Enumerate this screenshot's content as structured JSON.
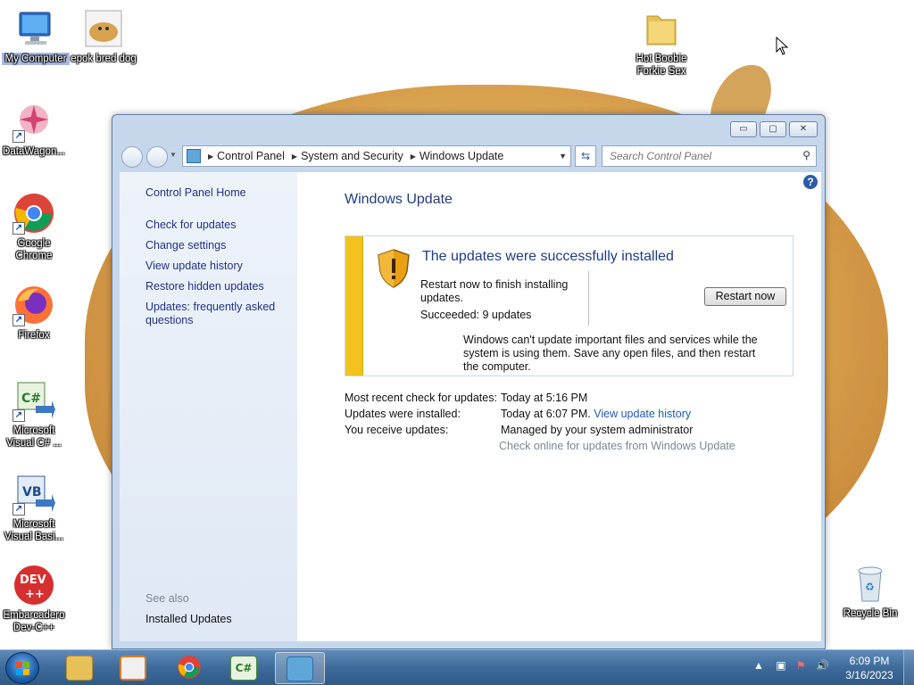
{
  "desktop_icons": [
    {
      "name": "My Computer",
      "label": "My Computer"
    },
    {
      "name": "epok bred dog",
      "label": "epok bred dog"
    },
    {
      "name": "Hot Boobie Forkie Sex",
      "label": "Hot Boobie Forkie Sex"
    },
    {
      "name": "DataWagon",
      "label": "DataWagon..."
    },
    {
      "name": "Google Chrome",
      "label": "Google Chrome"
    },
    {
      "name": "Firefox",
      "label": "Firefox"
    },
    {
      "name": "Microsoft Visual C#",
      "label": "Microsoft Visual C# ..."
    },
    {
      "name": "Microsoft Visual Basic",
      "label": "Microsoft Visual Basi..."
    },
    {
      "name": "Embarcadero Dev-C++",
      "label": "Embarcadero Dev-C++"
    },
    {
      "name": "Recycle Bin",
      "label": "Recycle Bin"
    }
  ],
  "window": {
    "title_buttons": {
      "minimize": "▭",
      "maximize": "▢",
      "close": "✕"
    },
    "breadcrumb": [
      "Control Panel",
      "System and Security",
      "Windows Update"
    ],
    "search_placeholder": "Search Control Panel"
  },
  "sidebar": {
    "home": "Control Panel Home",
    "links": [
      "Check for updates",
      "Change settings",
      "View update history",
      "Restore hidden updates",
      "Updates: frequently asked questions"
    ],
    "see_also": "See also",
    "installed_updates": "Installed Updates"
  },
  "main": {
    "title": "Windows Update",
    "status_panel": {
      "heading": "The updates were successfully installed",
      "restart_text": "Restart now to finish installing updates.",
      "succeeded": "Succeeded: 9 updates",
      "button_label": "Restart now",
      "warning_text": "Windows can't update important files and services while the system is using them. Save any open files, and then restart the computer."
    },
    "info": {
      "recent_check_label": "Most recent check for updates:",
      "recent_check_value": "Today at 5:16 PM",
      "installed_label": "Updates were installed:",
      "installed_value": "Today at 6:07 PM.",
      "installed_link": "View update history",
      "receive_label": "You receive updates:",
      "receive_value": "Managed by your system administrator",
      "online_check": "Check online for updates from Windows Update"
    }
  },
  "taskbar": {
    "time": "6:09 PM",
    "date": "3/16/2023"
  },
  "colors": {
    "accent_link": "#1e3287",
    "title_blue": "#1e3d84",
    "warning_stripe": "#f3c21c",
    "taskbar": "#3f6b9b"
  }
}
